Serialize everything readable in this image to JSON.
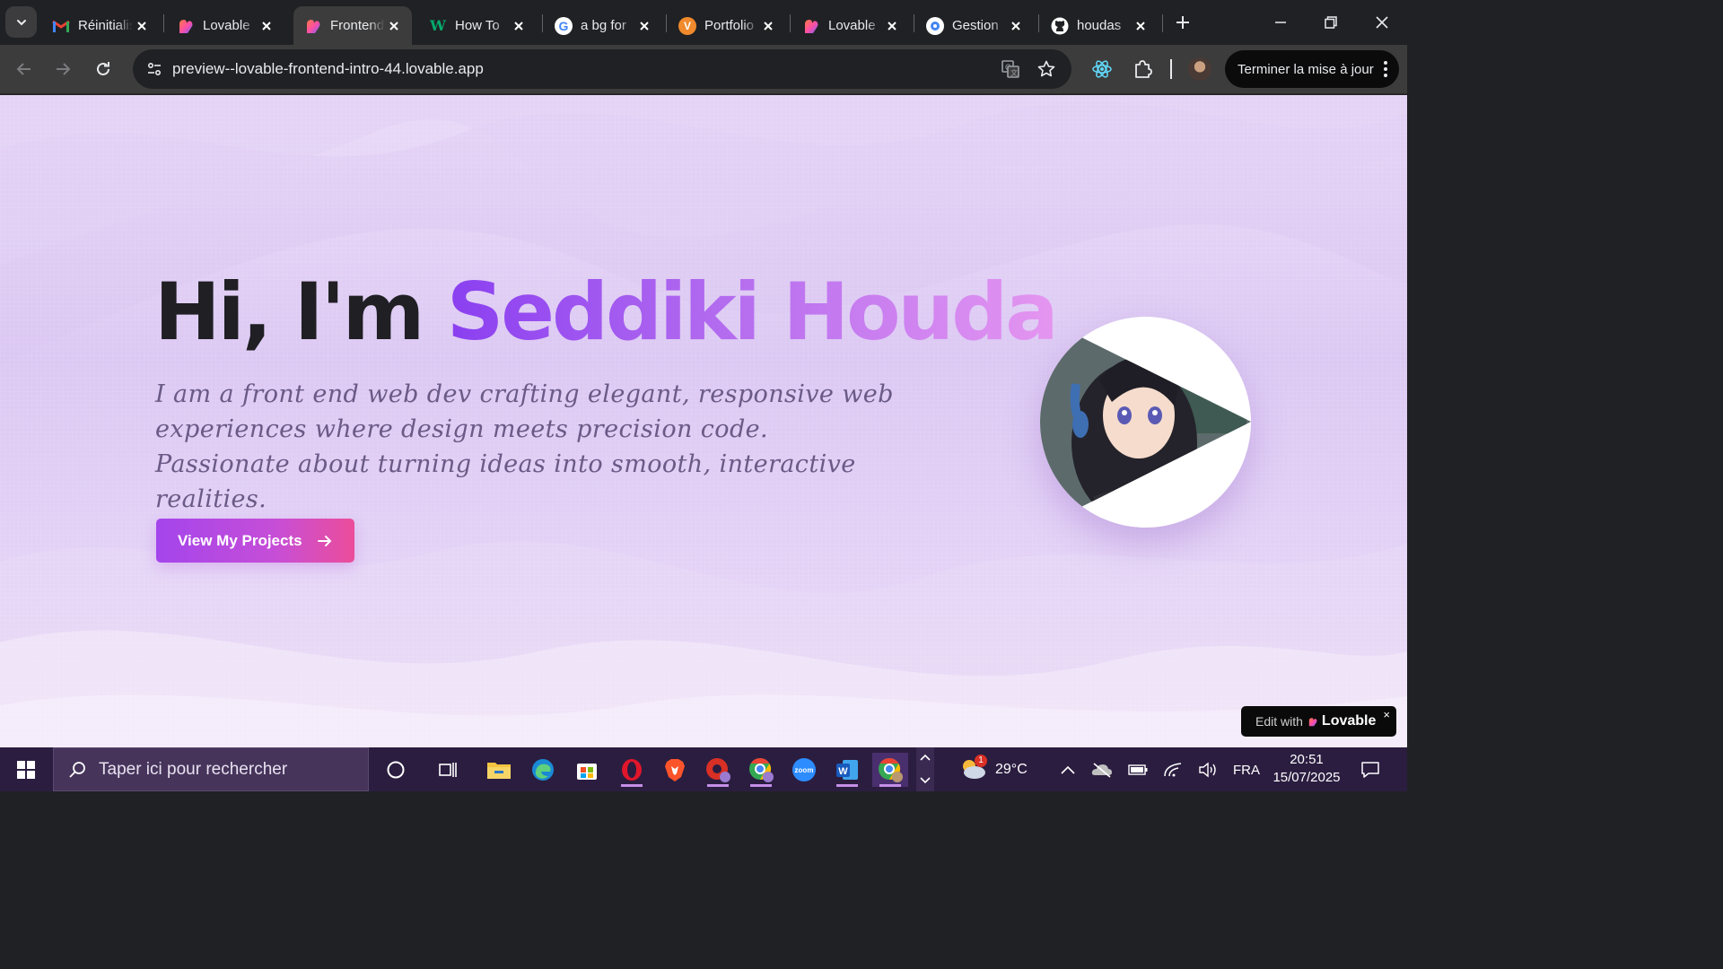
{
  "browser": {
    "tabs": [
      {
        "title": "Réinitialiser",
        "icon": "gmail-icon"
      },
      {
        "title": "Lovable",
        "icon": "lovable-icon"
      },
      {
        "title": "Frontend",
        "icon": "lovable-icon",
        "active": true
      },
      {
        "title": "How To",
        "icon": "w3schools-icon"
      },
      {
        "title": "a bg for",
        "icon": "google-icon"
      },
      {
        "title": "Portfolio",
        "icon": "portfolio-icon"
      },
      {
        "title": "Lovable",
        "icon": "lovable-icon"
      },
      {
        "title": "Gestion",
        "icon": "google-cloud-icon"
      },
      {
        "title": "houdas",
        "icon": "github-icon"
      }
    ],
    "url": "preview--lovable-frontend-intro-44.lovable.app",
    "update_button": "Terminer la mise à jour"
  },
  "hero": {
    "greeting": "Hi, I'm",
    "name": "Seddiki Houda",
    "subtitle": "I am a front end web dev crafting elegant, responsive web experiences where design meets precision code. Passionate about turning ideas into smooth, interactive realities.",
    "cta_label": "View My Projects"
  },
  "badge": {
    "prefix": "Edit with",
    "brand": "Lovable",
    "close": "×"
  },
  "taskbar": {
    "search_placeholder": "Taper ici pour rechercher",
    "weather_temp": "29°C",
    "weather_badge": "1",
    "language": "FRA",
    "time": "20:51",
    "date": "15/07/2025"
  },
  "colors": {
    "accent_purple": "#8a3ff0",
    "accent_pink": "#ec4d9a",
    "page_bg": "#dcc9f3",
    "taskbar_bg": "#2b1d40"
  }
}
